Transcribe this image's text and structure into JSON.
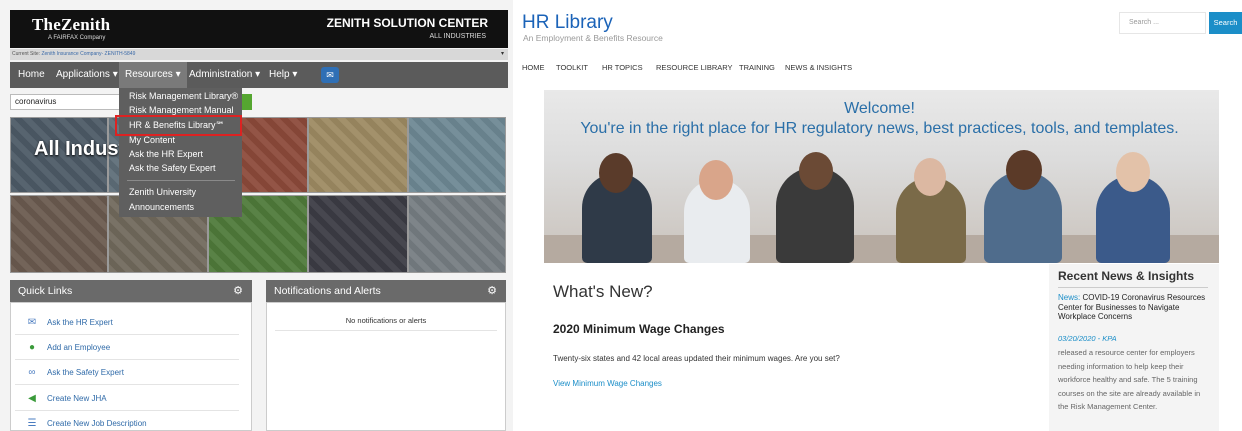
{
  "zenith": {
    "brand": "TheZenith",
    "brand_sub": "A FAIRFAX Company",
    "center_title": "ZENITH SOLUTION CENTER",
    "center_sub": "ALL INDUSTRIES",
    "current_site_label": "Current Site:",
    "current_site_value": "Zenith Insurance Company- ZENITH-5849",
    "nav": {
      "home": "Home",
      "applications": "Applications ▾",
      "resources": "Resources ▾",
      "administration": "Administration ▾",
      "help": "Help ▾",
      "mail_icon": "envelope-icon"
    },
    "search_value": "coronavirus",
    "banner_text": "All Indust",
    "resources_menu": {
      "items": [
        "Risk Management Library®",
        "Risk Management Manual",
        "HR & Benefits Library℠",
        "My Content",
        "Ask the HR Expert",
        "Ask the Safety Expert",
        "Zenith University",
        "Announcements"
      ]
    },
    "quick_links": {
      "title": "Quick Links",
      "items": [
        {
          "label": "Ask the HR Expert",
          "icon": "envelope-icon"
        },
        {
          "label": "Add an Employee",
          "icon": "person-icon"
        },
        {
          "label": "Ask the Safety Expert",
          "icon": "link-icon"
        },
        {
          "label": "Create New JHA",
          "icon": "megaphone-icon"
        },
        {
          "label": "Create New Job Description",
          "icon": "list-icon"
        }
      ]
    },
    "notifications": {
      "title": "Notifications and Alerts",
      "empty_text": "No notifications or alerts"
    },
    "colors": {
      "nav": "#5b5b5b",
      "highlight": "#dd2222",
      "link": "#2f6aa8"
    }
  },
  "hr": {
    "title": "HR Library",
    "tagline": "An Employment & Benefits Resource",
    "search_placeholder": "Search ...",
    "search_button": "Search",
    "nav": [
      "HOME",
      "TOOLKIT",
      "HR TOPICS",
      "RESOURCE LIBRARY",
      "TRAINING",
      "NEWS & INSIGHTS"
    ],
    "hero_line1": "Welcome!",
    "hero_line2": "You're in the right place for HR regulatory news, best practices, tools, and templates.",
    "whats_new": "What's New?",
    "article_title": "2020 Minimum Wage Changes",
    "article_text": "Twenty-six states and 42 local areas updated their minimum wages. Are you set?",
    "article_link": "View Minimum Wage Changes",
    "sidebar": {
      "title": "Recent News & Insights",
      "news_label": "News:",
      "news_text": "COVID-19 Coronavirus Resources Center for Businesses to Navigate Workplace Concerns",
      "date": "03/20/2020 - KPA",
      "body": "released a resource center for employers needing information to help keep their workforce healthy and safe. The 5 training courses on the site are already available in the Risk Management Center."
    },
    "colors": {
      "brand": "#1b63b8",
      "accent": "#1b8ec8"
    }
  }
}
